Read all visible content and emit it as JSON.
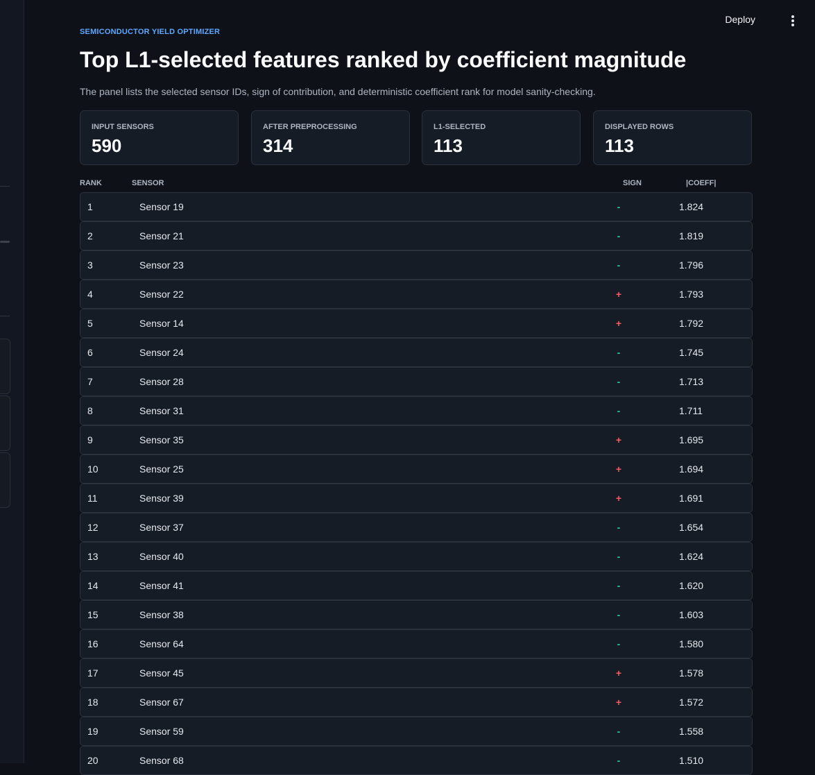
{
  "topbar": {
    "deploy_label": "Deploy",
    "menu_icon": "more-vertical-icon"
  },
  "header": {
    "eyebrow": "SEMICONDUCTOR YIELD OPTIMIZER",
    "title": "Top L1-selected features ranked by coefficient magnitude",
    "subtitle": "The panel lists the selected sensor IDs, sign of contribution, and deterministic coefficient rank for model sanity-checking."
  },
  "metrics": [
    {
      "label": "INPUT SENSORS",
      "value": "590"
    },
    {
      "label": "AFTER PREPROCESSING",
      "value": "314"
    },
    {
      "label": "L1-SELECTED",
      "value": "113"
    },
    {
      "label": "DISPLAYED ROWS",
      "value": "113"
    }
  ],
  "table": {
    "columns": {
      "rank": "RANK",
      "sensor": "SENSOR",
      "sign": "SIGN",
      "coeff": "|COEFF|"
    },
    "rows": [
      {
        "rank": "1",
        "sensor": "Sensor 19",
        "sign": "-",
        "coeff": "1.824"
      },
      {
        "rank": "2",
        "sensor": "Sensor 21",
        "sign": "-",
        "coeff": "1.819"
      },
      {
        "rank": "3",
        "sensor": "Sensor 23",
        "sign": "-",
        "coeff": "1.796"
      },
      {
        "rank": "4",
        "sensor": "Sensor 22",
        "sign": "+",
        "coeff": "1.793"
      },
      {
        "rank": "5",
        "sensor": "Sensor 14",
        "sign": "+",
        "coeff": "1.792"
      },
      {
        "rank": "6",
        "sensor": "Sensor 24",
        "sign": "-",
        "coeff": "1.745"
      },
      {
        "rank": "7",
        "sensor": "Sensor 28",
        "sign": "-",
        "coeff": "1.713"
      },
      {
        "rank": "8",
        "sensor": "Sensor 31",
        "sign": "-",
        "coeff": "1.711"
      },
      {
        "rank": "9",
        "sensor": "Sensor 35",
        "sign": "+",
        "coeff": "1.695"
      },
      {
        "rank": "10",
        "sensor": "Sensor 25",
        "sign": "+",
        "coeff": "1.694"
      },
      {
        "rank": "11",
        "sensor": "Sensor 39",
        "sign": "+",
        "coeff": "1.691"
      },
      {
        "rank": "12",
        "sensor": "Sensor 37",
        "sign": "-",
        "coeff": "1.654"
      },
      {
        "rank": "13",
        "sensor": "Sensor 40",
        "sign": "-",
        "coeff": "1.624"
      },
      {
        "rank": "14",
        "sensor": "Sensor 41",
        "sign": "-",
        "coeff": "1.620"
      },
      {
        "rank": "15",
        "sensor": "Sensor 38",
        "sign": "-",
        "coeff": "1.603"
      },
      {
        "rank": "16",
        "sensor": "Sensor 64",
        "sign": "-",
        "coeff": "1.580"
      },
      {
        "rank": "17",
        "sensor": "Sensor 45",
        "sign": "+",
        "coeff": "1.578"
      },
      {
        "rank": "18",
        "sensor": "Sensor 67",
        "sign": "+",
        "coeff": "1.572"
      },
      {
        "rank": "19",
        "sensor": "Sensor 59",
        "sign": "-",
        "coeff": "1.558"
      },
      {
        "rank": "20",
        "sensor": "Sensor 68",
        "sign": "-",
        "coeff": "1.510"
      }
    ]
  },
  "colors": {
    "accent": "#5fa8ff",
    "negative_sign": "#35c59a",
    "positive_sign": "#ff5a64",
    "background": "#0e1117",
    "card": "#161c25"
  }
}
